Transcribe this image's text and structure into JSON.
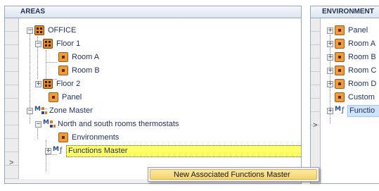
{
  "areas": {
    "header": "AREAS",
    "tree": [
      {
        "label": "OFFICE",
        "icon": "floor-grid-icon"
      },
      {
        "label": "Floor 1",
        "icon": "floor-grid-icon"
      },
      {
        "label": "Room A",
        "icon": "environment-icon"
      },
      {
        "label": "Room B",
        "icon": "environment-icon"
      },
      {
        "label": "Floor 2",
        "icon": "floor-grid-icon"
      },
      {
        "label": "Panel",
        "icon": "environment-icon"
      },
      {
        "label": "Zone Master",
        "icon": "zone-master-icon"
      },
      {
        "label": "North and south rooms thermostats",
        "icon": "zone-master-icon"
      },
      {
        "label": "Environments",
        "icon": "environment-icon"
      },
      {
        "label": "Functions Master",
        "icon": "functions-master-icon",
        "selected": true
      }
    ]
  },
  "environments": {
    "header": "ENVIRONMENT",
    "tree": [
      {
        "label": "Panel",
        "icon": "environment-icon"
      },
      {
        "label": "Room A",
        "icon": "environment-icon"
      },
      {
        "label": "Room B",
        "icon": "environment-icon"
      },
      {
        "label": "Room C",
        "icon": "environment-icon"
      },
      {
        "label": "Room D",
        "icon": "environment-icon"
      },
      {
        "label": "Custom",
        "icon": "custom-environment-icon"
      },
      {
        "label": "Functio",
        "icon": "functions-master-icon",
        "selected": true
      }
    ]
  },
  "context_menu": {
    "items": [
      {
        "label": "New  Associated Functions Master"
      }
    ]
  },
  "colors": {
    "selected_yellow": "#ffff66",
    "selected_blue": "#cfe4fb",
    "menu_highlight": "#f6d468",
    "header_text": "#1f2f5a"
  }
}
